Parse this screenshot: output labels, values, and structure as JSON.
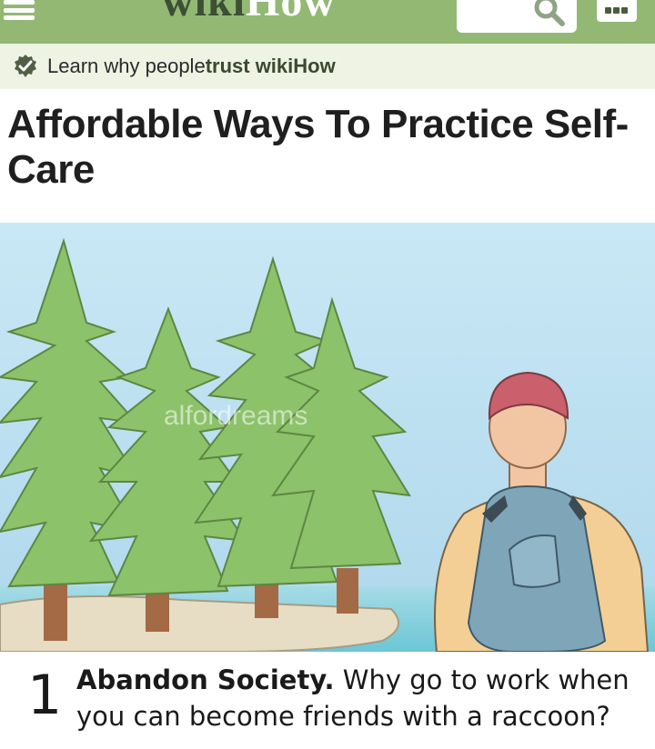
{
  "header": {
    "logo_part1": "wiki",
    "logo_part2": "How",
    "menu_icon": "hamburger-icon",
    "search_icon": "magnifier-icon",
    "profile_icon": "grid-icon"
  },
  "trust_banner": {
    "icon": "verified-badge-icon",
    "text": "Learn why people ",
    "link": "trust wikiHow"
  },
  "article": {
    "title": "Affordable Ways To Practice Self-Care",
    "watermark": "alfordreams",
    "step_number": "1",
    "step_heading": "Abandon Society.",
    "step_body": " Why go to work when you can become friends with a raccoon?"
  },
  "colors": {
    "header_bg": "#93b874",
    "banner_bg": "#eef3e4",
    "sky": "#bfe2f2",
    "tree": "#7fb55e",
    "cap": "#c95d6a",
    "backpack": "#7ea3b6"
  }
}
